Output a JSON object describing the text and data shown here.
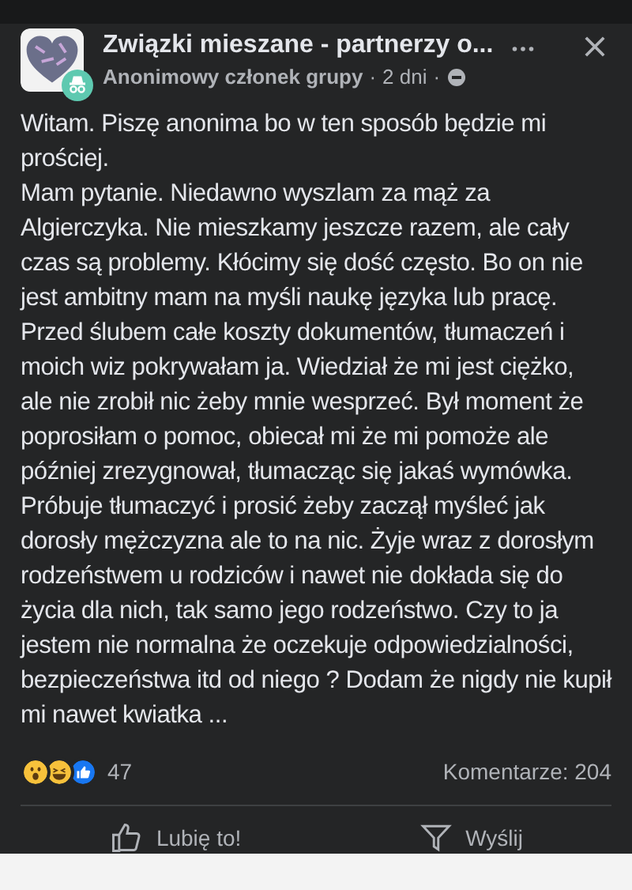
{
  "post": {
    "group_title": "Związki mieszane - partnerzy o...",
    "author": "Anonimowy członek grupy",
    "separator_1": "·",
    "time": "2 dni",
    "separator_2": "·",
    "paragraphs": [
      "Witam. Piszę anonima bo w ten sposób będzie mi prościej.",
      "Mam pytanie. Niedawno wyszlam za mąż za Algierczyka. Nie mieszkamy jeszcze razem, ale cały czas są problemy. Kłócimy się dość często. Bo on nie jest ambitny mam na myśli naukę języka lub pracę. Przed ślubem całe koszty dokumentów, tłumaczeń i moich wiz pokrywałam ja. Wiedział że mi jest ciężko, ale nie zrobił nic żeby mnie wesprzeć. Był moment że poprosiłam o pomoc, obiecał mi że mi pomoże ale później zrezygnował, tłumacząc się jakaś wymówka. Próbuje tłumaczyć i prosić żeby zaczął myśleć jak dorosły mężczyzna ale to na nic. Żyje wraz z dorosłym rodzeństwem u rodziców i nawet nie dokłada się do życia dla nich, tak samo jego rodzeństwo. Czy to ja jestem nie normalna że oczekuje odpowiedzialności, bezpieczeństwa itd od niego ? Dodam że nigdy nie kupił mi nawet kwiatka ..."
    ],
    "reactions": [
      {
        "kind": "wow"
      },
      {
        "kind": "haha"
      },
      {
        "kind": "like"
      }
    ],
    "reaction_count": "47",
    "comments": "Komentarze: 204",
    "actions": [
      {
        "kind": "like",
        "label": "Lubię to!"
      },
      {
        "kind": "send",
        "label": "Wyślij"
      }
    ]
  }
}
